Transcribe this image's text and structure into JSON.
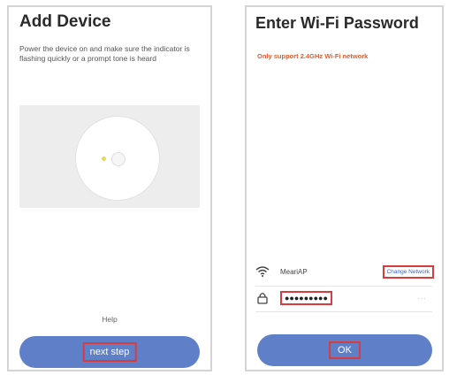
{
  "left_screen": {
    "title": "Add Device",
    "description": "Power the device on and make sure the indicator is flashing quickly or a prompt tone is heard",
    "help_label": "Help",
    "next_button_label": "next step"
  },
  "right_screen": {
    "title": "Enter Wi-Fi Password",
    "warning": "Only support 2.4GHz Wi-Fi network",
    "network_name": "MeariAP",
    "change_network_label": "Change Network",
    "password_value": "●●●●●●●●●",
    "ok_button_label": "OK"
  },
  "colors": {
    "button": "#5f80c9",
    "highlight_box": "#d83c3c",
    "warning_text": "#e65a2a",
    "link_text": "#3a64c8"
  },
  "icons": [
    "wifi-icon",
    "lock-icon",
    "eye-icon"
  ]
}
